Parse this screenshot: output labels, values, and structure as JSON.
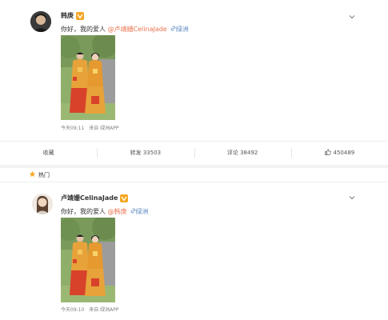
{
  "posts": [
    {
      "username": "韩庚",
      "text_before": "你好，我的爱人 ",
      "mention": "@卢靖姗CelinaJade",
      "location": "绿洲",
      "time": "今天09:11",
      "source": "来自 绿洲APP",
      "actions": {
        "favorite": "收藏",
        "repost": "转发 33503",
        "comment": "评论 38492",
        "like": "450489"
      }
    },
    {
      "username": "卢靖姗CelinaJade",
      "text_before": "你好，我的爱人 ",
      "mention": "@韩庚",
      "location": "绿洲",
      "time": "今天09:10",
      "source": "来自 绿洲APP"
    }
  ],
  "hot_label": "热门",
  "colors": {
    "mention": "#eb7350",
    "link": "#5f8ac2",
    "verified_badge": "#f5a623",
    "robe_red": "#d8422a",
    "robe_gold": "#e8a23a"
  },
  "icons": {
    "verified": "verified-badge-icon",
    "menu": "chevron-down-icon",
    "location": "location-link-icon",
    "like": "thumbs-up-icon",
    "hot": "star-icon"
  }
}
